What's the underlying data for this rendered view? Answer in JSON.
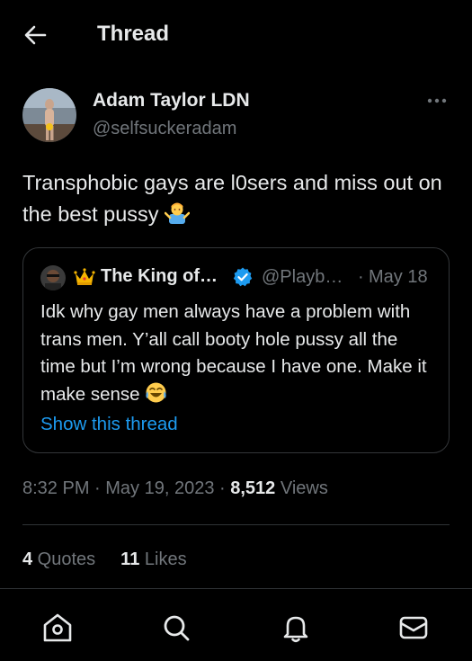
{
  "header": {
    "title": "Thread"
  },
  "author": {
    "name": "Adam Taylor LDN",
    "handle": "@selfsuckeradam"
  },
  "tweet": {
    "text": "Transphobic gays are l0sers and miss out on the best pussy"
  },
  "quote": {
    "name": "The King of…",
    "handle": "@Playb…",
    "separator": "·",
    "date": "May 18",
    "text": "Idk why gay men always have a problem with trans men. Y’all call booty hole pussy all the time but I’m wrong because I have one. Make it make sense",
    "show_thread": "Show this thread"
  },
  "meta": {
    "time": "8:32 PM",
    "sep1": " · ",
    "date": "May 19, 2023",
    "sep2": " · ",
    "views_count": "8,512",
    "views_label": " Views"
  },
  "stats": {
    "quotes_count": "4",
    "quotes_label": " Quotes",
    "likes_count": "11",
    "likes_label": " Likes"
  },
  "icons": {
    "back": "arrow-left-icon",
    "more": "more-horizontal-icon",
    "verified": "verified-badge-icon",
    "home": "home-icon",
    "search": "search-icon",
    "notifications": "bell-icon",
    "messages": "mail-icon"
  },
  "colors": {
    "background": "#000000",
    "text": "#e7e9ea",
    "muted": "#71767b",
    "link": "#1d9bf0",
    "border": "#2f3336"
  }
}
